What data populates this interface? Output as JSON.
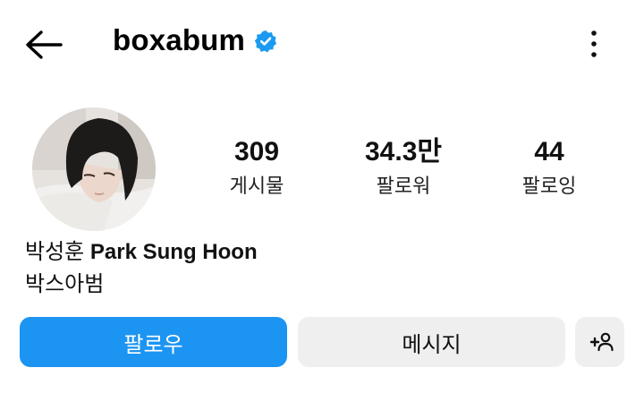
{
  "header": {
    "back_icon": "arrow-left-icon",
    "username": "boxabum",
    "verified_icon": "verified-badge-icon",
    "more_icon": "more-vertical-icon"
  },
  "profile": {
    "avatar_alt": "profile photo",
    "stats": [
      {
        "count": "309",
        "label": "게시물"
      },
      {
        "count": "34.3만",
        "label": "팔로워"
      },
      {
        "count": "44",
        "label": "팔로잉"
      }
    ],
    "name_korean": "박성훈",
    "name_latin": "Park Sung Hoon",
    "bio": "박스아범"
  },
  "actions": {
    "follow_label": "팔로우",
    "message_label": "메시지",
    "add_user_icon": "add-user-icon"
  },
  "colors": {
    "accent": "#1c94f2",
    "secondary_button": "#efefef",
    "verified": "#1a9af0"
  }
}
